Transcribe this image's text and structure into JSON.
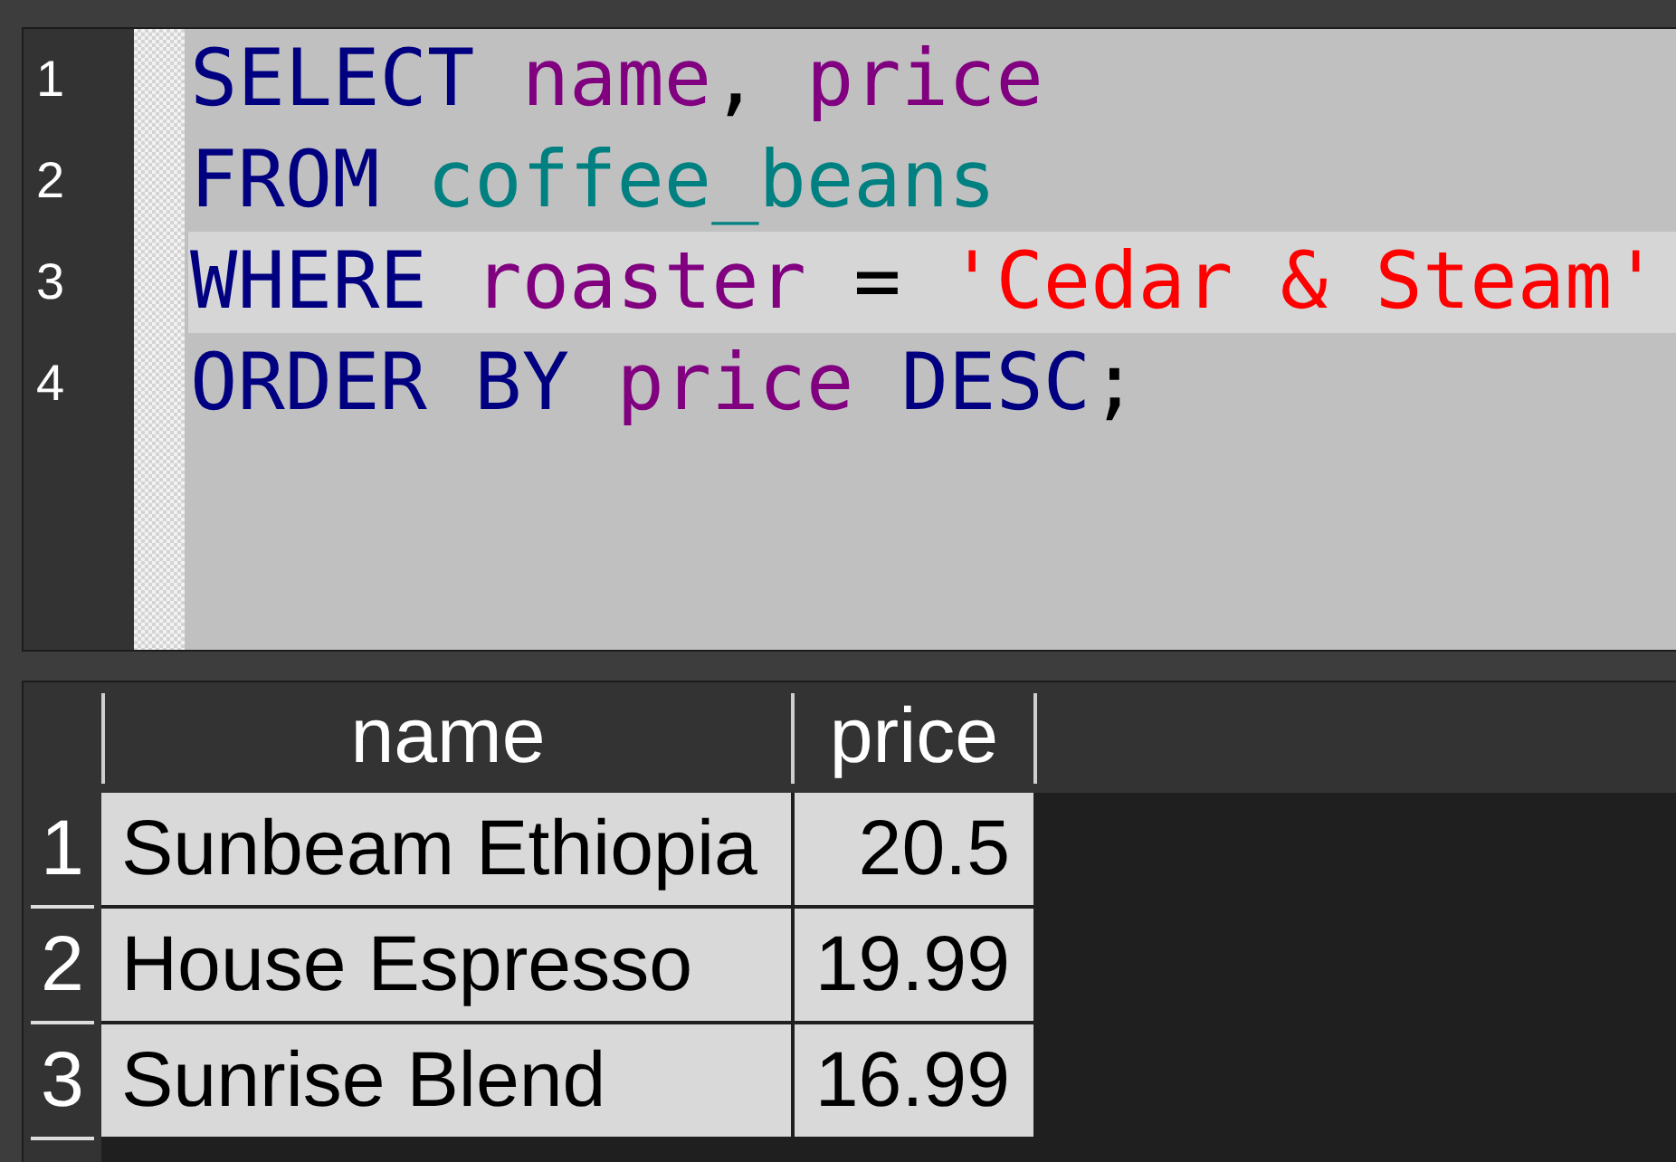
{
  "editor": {
    "lines": [
      {
        "number": "1",
        "current": false,
        "tokens": [
          {
            "kind": "keyword",
            "text": "SELECT "
          },
          {
            "kind": "column",
            "text": "name"
          },
          {
            "kind": "plain",
            "text": ", "
          },
          {
            "kind": "column",
            "text": "price"
          }
        ]
      },
      {
        "number": "2",
        "current": false,
        "tokens": [
          {
            "kind": "keyword",
            "text": "FROM "
          },
          {
            "kind": "table",
            "text": "coffee_beans"
          }
        ]
      },
      {
        "number": "3",
        "current": true,
        "tokens": [
          {
            "kind": "keyword",
            "text": "WHERE "
          },
          {
            "kind": "column",
            "text": "roaster "
          },
          {
            "kind": "plain",
            "text": "= "
          },
          {
            "kind": "string",
            "text": "'Cedar & Steam'"
          }
        ]
      },
      {
        "number": "4",
        "current": false,
        "tokens": [
          {
            "kind": "keyword",
            "text": "ORDER BY "
          },
          {
            "kind": "column",
            "text": "price "
          },
          {
            "kind": "keyword",
            "text": "DESC"
          },
          {
            "kind": "plain",
            "text": ";"
          }
        ]
      }
    ]
  },
  "results": {
    "columns": [
      {
        "label": "name",
        "kind": "text"
      },
      {
        "label": "price",
        "kind": "number"
      }
    ],
    "rows": [
      {
        "number": "1",
        "cells": [
          "Sunbeam Ethiopia",
          "20.5"
        ]
      },
      {
        "number": "2",
        "cells": [
          "House Espresso",
          "19.99"
        ]
      },
      {
        "number": "3",
        "cells": [
          "Sunrise Blend",
          "16.99"
        ]
      }
    ]
  }
}
